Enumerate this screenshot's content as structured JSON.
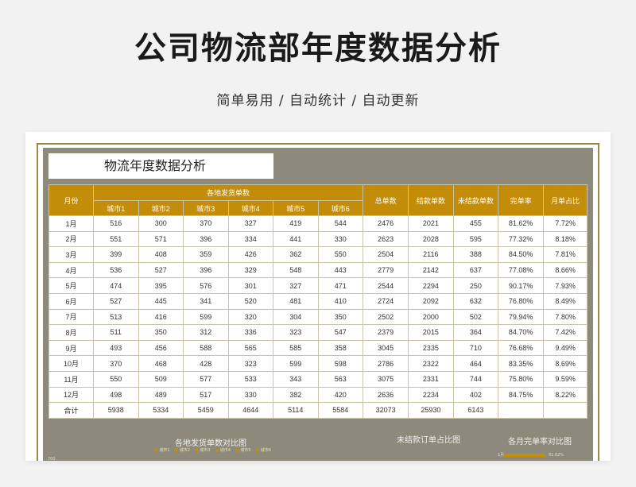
{
  "header": {
    "title": "公司物流部年度数据分析",
    "subtitle": "简单易用 / 自动统计 / 自动更新"
  },
  "sheet": {
    "title": "物流年度数据分析",
    "group_header": "各地发货单数",
    "col_month": "月份",
    "col_total": "总单数",
    "col_settled": "结款单数",
    "col_unsettled": "未结款单数",
    "col_rate": "完单率",
    "col_share": "月单占比",
    "cities": [
      "城市1",
      "城市2",
      "城市3",
      "城市4",
      "城市5",
      "城市6"
    ],
    "rows": [
      {
        "m": "1月",
        "c": [
          "516",
          "300",
          "370",
          "327",
          "419",
          "544"
        ],
        "t": "2476",
        "s": "2021",
        "u": "455",
        "r": "81.62%",
        "p": "7.72%"
      },
      {
        "m": "2月",
        "c": [
          "551",
          "571",
          "396",
          "334",
          "441",
          "330"
        ],
        "t": "2623",
        "s": "2028",
        "u": "595",
        "r": "77.32%",
        "p": "8.18%"
      },
      {
        "m": "3月",
        "c": [
          "399",
          "408",
          "359",
          "426",
          "362",
          "550"
        ],
        "t": "2504",
        "s": "2116",
        "u": "388",
        "r": "84.50%",
        "p": "7.81%"
      },
      {
        "m": "4月",
        "c": [
          "536",
          "527",
          "396",
          "329",
          "548",
          "443"
        ],
        "t": "2779",
        "s": "2142",
        "u": "637",
        "r": "77.08%",
        "p": "8.66%"
      },
      {
        "m": "5月",
        "c": [
          "474",
          "395",
          "576",
          "301",
          "327",
          "471"
        ],
        "t": "2544",
        "s": "2294",
        "u": "250",
        "r": "90.17%",
        "p": "7.93%"
      },
      {
        "m": "6月",
        "c": [
          "527",
          "445",
          "341",
          "520",
          "481",
          "410"
        ],
        "t": "2724",
        "s": "2092",
        "u": "632",
        "r": "76.80%",
        "p": "8.49%"
      },
      {
        "m": "7月",
        "c": [
          "513",
          "416",
          "599",
          "320",
          "304",
          "350"
        ],
        "t": "2502",
        "s": "2000",
        "u": "502",
        "r": "79.94%",
        "p": "7.80%"
      },
      {
        "m": "8月",
        "c": [
          "511",
          "350",
          "312",
          "336",
          "323",
          "547"
        ],
        "t": "2379",
        "s": "2015",
        "u": "364",
        "r": "84.70%",
        "p": "7.42%"
      },
      {
        "m": "9月",
        "c": [
          "493",
          "456",
          "588",
          "565",
          "585",
          "358"
        ],
        "t": "3045",
        "s": "2335",
        "u": "710",
        "r": "76.68%",
        "p": "9.49%"
      },
      {
        "m": "10月",
        "c": [
          "370",
          "468",
          "428",
          "323",
          "599",
          "598"
        ],
        "t": "2786",
        "s": "2322",
        "u": "464",
        "r": "83.35%",
        "p": "8.69%"
      },
      {
        "m": "11月",
        "c": [
          "550",
          "509",
          "577",
          "533",
          "343",
          "563"
        ],
        "t": "3075",
        "s": "2331",
        "u": "744",
        "r": "75.80%",
        "p": "9.59%"
      },
      {
        "m": "12月",
        "c": [
          "498",
          "489",
          "517",
          "330",
          "382",
          "420"
        ],
        "t": "2636",
        "s": "2234",
        "u": "402",
        "r": "84.75%",
        "p": "8.22%"
      }
    ],
    "total_row": {
      "m": "合计",
      "c": [
        "5938",
        "5334",
        "5459",
        "4644",
        "5114",
        "5584"
      ],
      "t": "32073",
      "s": "25930",
      "u": "6143",
      "r": "",
      "p": ""
    }
  },
  "charts": {
    "city_compare_title": "各地发货单数对比图",
    "unsettled_title": "未结款订单占比图",
    "rate_title": "各月完单率对比图",
    "legend": [
      "城市1",
      "城市2",
      "城市3",
      "城市4",
      "城市5",
      "城市6"
    ],
    "rate_tick": "1月",
    "rate_value": "81.62%",
    "y_tick": "700"
  },
  "colors": {
    "accent": "#c38d0a",
    "sheet_bg": "#8d8a7b"
  }
}
